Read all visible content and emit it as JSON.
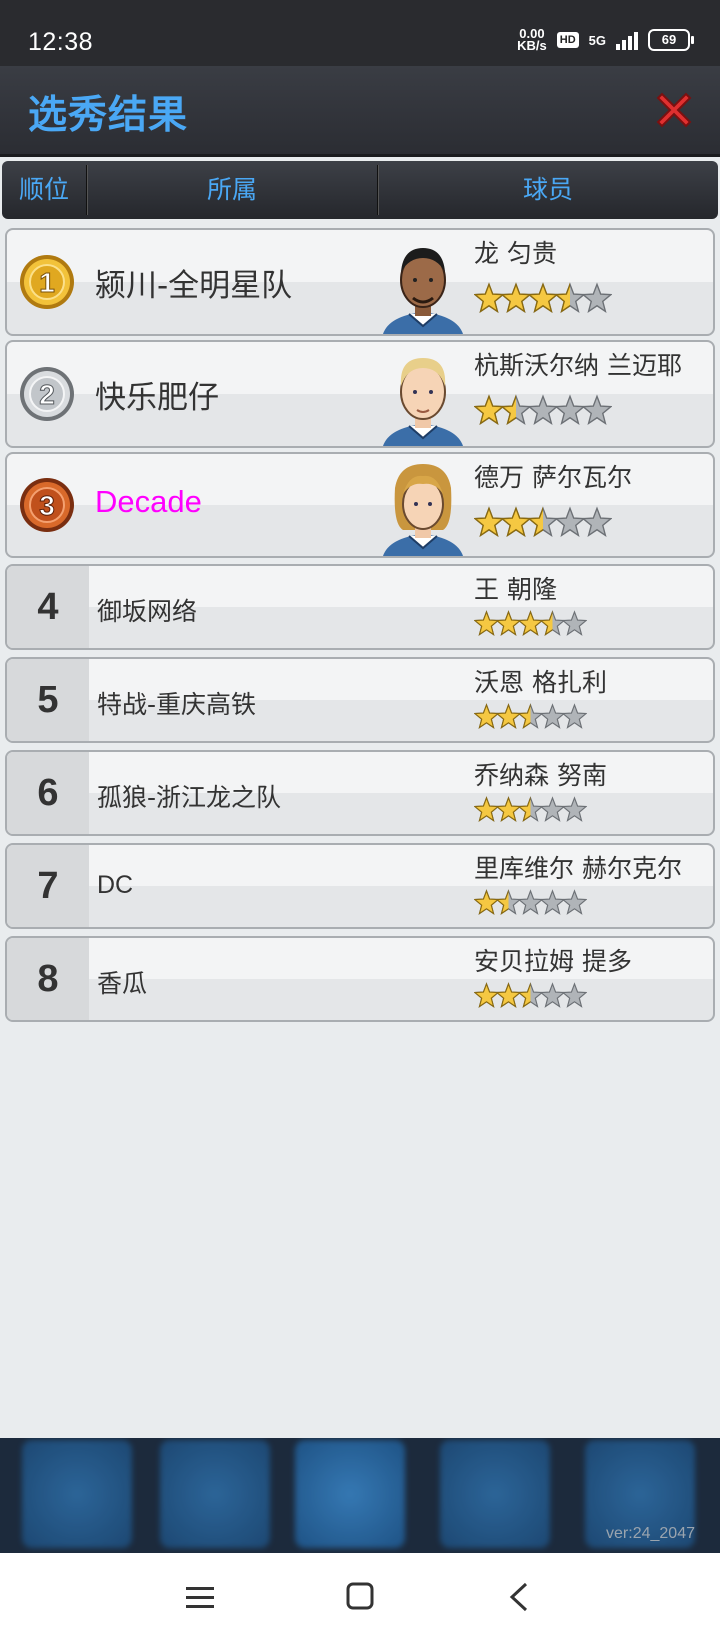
{
  "status": {
    "time": "12:38",
    "speed_value": "0.00",
    "speed_unit": "KB/s",
    "hd": "HD",
    "network": "5G",
    "battery": "69"
  },
  "header": {
    "title": "选秀结果"
  },
  "columns": {
    "rank": "顺位",
    "team": "所属",
    "player": "球员"
  },
  "picks": [
    {
      "rank": "1",
      "team": "颍川-全明星队",
      "player": "龙 匀贵",
      "stars": 3.5
    },
    {
      "rank": "2",
      "team": "快乐肥仔",
      "player": "杭斯沃尔纳 兰迈耶",
      "stars": 1.5
    },
    {
      "rank": "3",
      "team": "Decade",
      "player": "德万 萨尔瓦尔",
      "stars": 2.5,
      "highlight_color": "#ff00ff"
    },
    {
      "rank": "4",
      "team": "御坂网络",
      "player": "王 朝隆",
      "stars": 3.5
    },
    {
      "rank": "5",
      "team": "特战-重庆高铁",
      "player": "沃恩 格扎利",
      "stars": 2.5
    },
    {
      "rank": "6",
      "team": "孤狼-浙江龙之队",
      "player": "乔纳森 努南",
      "stars": 2.5
    },
    {
      "rank": "7",
      "team": "DC",
      "player": "里库维尔 赫尔克尔",
      "stars": 1.5
    },
    {
      "rank": "8",
      "team": "香瓜",
      "player": "安贝拉姆 提多",
      "stars": 2.5
    }
  ],
  "footer": {
    "version": "ver:24_2047"
  },
  "colors": {
    "accent": "#4aa8f5",
    "close": "#e03030",
    "star_gold": "#f5c842",
    "star_grey": "#b0b4b8"
  }
}
